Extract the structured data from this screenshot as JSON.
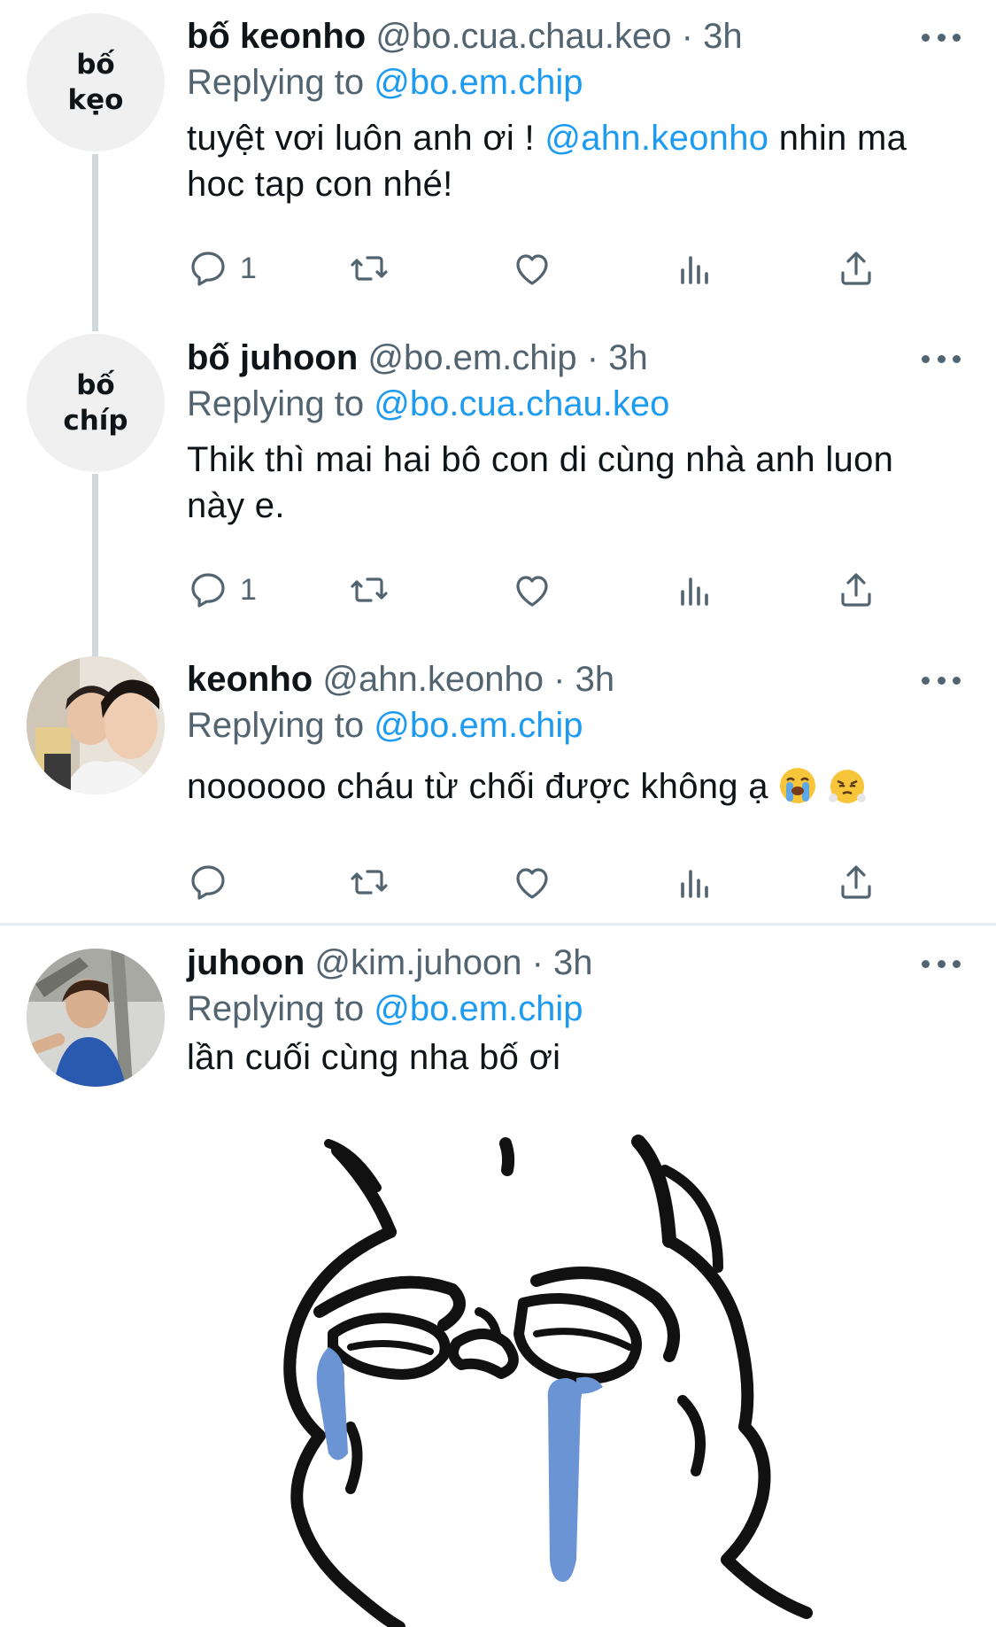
{
  "tweets": [
    {
      "avatar_text": "bố\nkẹo",
      "name": "bố keonho",
      "handle": "@bo.cua.chau.keo",
      "time": "3h",
      "replying_label": "Replying to",
      "replying_to": "@bo.em.chip",
      "text_before": "tuyệt vơi luôn anh ơi ! ",
      "mention": "@ahn.keonho",
      "text_after": " nhin ma hoc tap con nhé!",
      "reply_count": "1"
    },
    {
      "avatar_text": "bố\nchíp",
      "name": "bố juhoon",
      "handle": "@bo.em.chip",
      "time": "3h",
      "replying_label": "Replying to",
      "replying_to": "@bo.cua.chau.keo",
      "text": "Thik thì mai hai bô con di cùng nhà anh luon này e.",
      "reply_count": "1"
    },
    {
      "name": "keonho",
      "handle": "@ahn.keonho",
      "time": "3h",
      "replying_label": "Replying to",
      "replying_to": "@bo.em.chip",
      "text": "noooooo cháu từ chối được không ạ ",
      "emojis": [
        "loudly-crying-face-emoji",
        "face-with-steam-emoji"
      ]
    },
    {
      "name": "juhoon",
      "handle": "@kim.juhoon",
      "time": "3h",
      "replying_label": "Replying to",
      "replying_to": "@bo.em.chip",
      "text": "lần cuối cùng nha bố ơi",
      "media": "crying-cartoon-face-drawing"
    }
  ],
  "separator": "·",
  "icons": [
    "reply-icon",
    "retweet-icon",
    "like-icon",
    "analytics-icon",
    "share-icon",
    "more-icon"
  ],
  "colors": {
    "accent": "#1d9bf0",
    "secondary_text": "#536471",
    "tear_blue": "#6a94d4"
  }
}
